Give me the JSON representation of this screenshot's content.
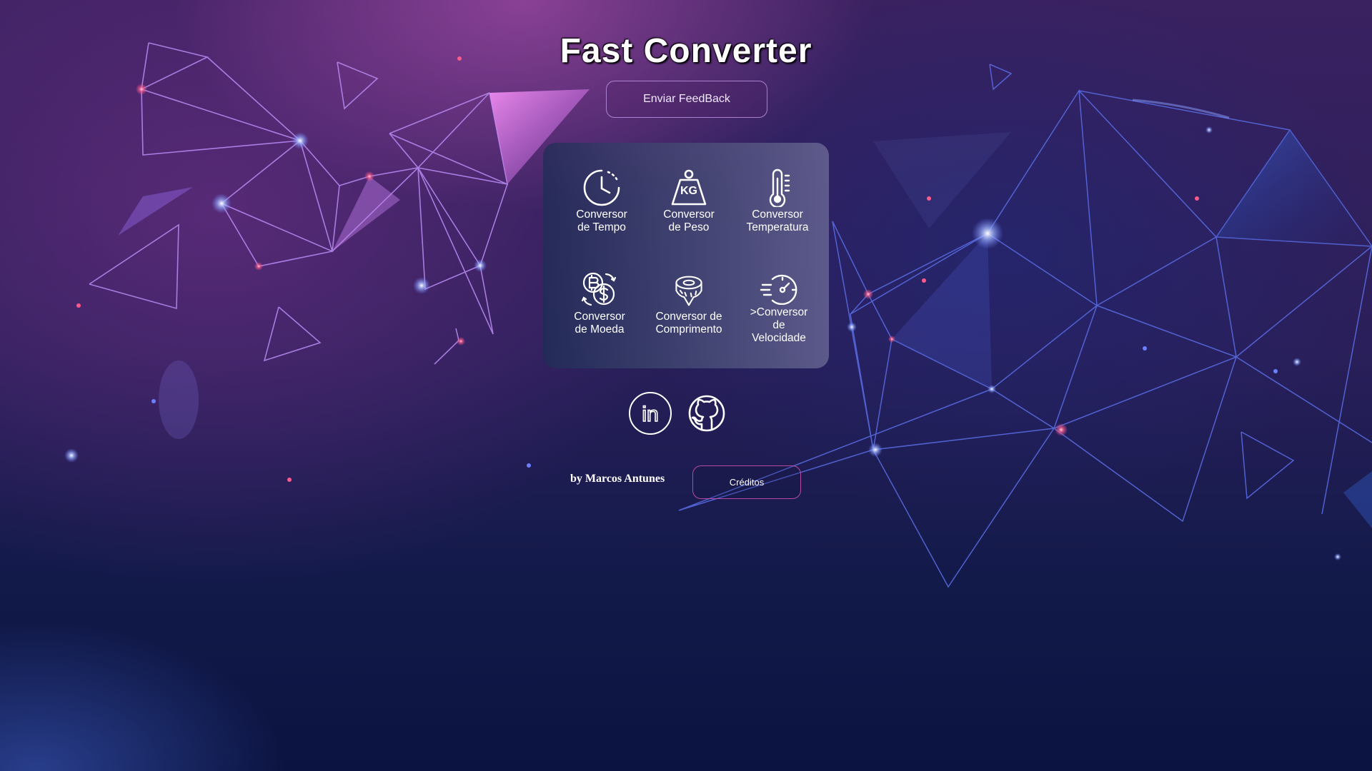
{
  "header": {
    "title": "Fast Converter"
  },
  "feedback": {
    "label": "Enviar FeedBack"
  },
  "converters": [
    {
      "line1": "Conversor",
      "line2": "de Tempo",
      "icon": "clock-icon"
    },
    {
      "line1": "Conversor",
      "line2": "de Peso",
      "icon": "kg-weight-icon",
      "icon_text": "KG"
    },
    {
      "line1": "Conversor",
      "line2": "Temperatura",
      "icon": "thermometer-icon"
    },
    {
      "line1": "Conversor",
      "line2": "de Moeda",
      "icon": "currency-exchange-icon"
    },
    {
      "line1": "Conversor de",
      "line2": "Comprimento",
      "icon": "measuring-tape-icon"
    },
    {
      "line1": ">Conversor",
      "line2": "de",
      "line3": "Velocidade",
      "icon": "speedometer-icon"
    }
  ],
  "social": [
    {
      "name": "LinkedIn",
      "icon": "linkedin-icon",
      "icon_text": "in"
    },
    {
      "name": "GitHub",
      "icon": "github-icon"
    }
  ],
  "footer": {
    "byline": "by Marcos Antunes",
    "credits_label": "Créditos"
  },
  "colors": {
    "accent_pink": "#c85ab4",
    "line_purple": "#b98cf5",
    "line_blue": "#5a6ee6",
    "text": "#ffffff"
  }
}
